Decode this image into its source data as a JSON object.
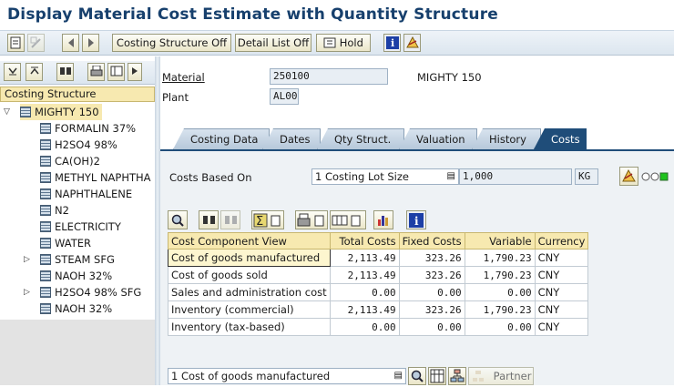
{
  "title": "Display Material Cost Estimate with Quantity Structure",
  "toolbar": {
    "costing_structure_off": "Costing Structure Off",
    "detail_list_off": "Detail List Off",
    "hold": "Hold"
  },
  "left_panel": {
    "header": "Costing Structure",
    "root": "MIGHTY 150",
    "items": [
      {
        "label": "FORMALIN 37%"
      },
      {
        "label": "H2SO4 98%"
      },
      {
        "label": "CA(OH)2"
      },
      {
        "label": "METHYL NAPHTHA"
      },
      {
        "label": "NAPHTHALENE"
      },
      {
        "label": "N2"
      },
      {
        "label": "ELECTRICITY"
      },
      {
        "label": "WATER"
      },
      {
        "label": "STEAM SFG"
      },
      {
        "label": "NAOH 32%"
      },
      {
        "label": "H2SO4 98% SFG"
      },
      {
        "label": "NAOH 32%"
      }
    ]
  },
  "header_fields": {
    "material_label": "Material",
    "material_value": "250100",
    "material_desc": "MIGHTY 150",
    "plant_label": "Plant",
    "plant_value": "AL00"
  },
  "tabs": [
    "Costing Data",
    "Dates",
    "Qty Struct.",
    "Valuation",
    "History",
    "Costs"
  ],
  "active_tab": "Costs",
  "costs_based_on": {
    "label": "Costs Based On",
    "value": "1 Costing Lot Size",
    "quantity": "1,000",
    "unit": "KG"
  },
  "table": {
    "headers": [
      "Cost Component View",
      "Total Costs",
      "Fixed Costs",
      "Variable",
      "Currency"
    ],
    "rows": [
      [
        "Cost of goods manufactured",
        "2,113.49",
        "323.26",
        "1,790.23",
        "CNY"
      ],
      [
        "Cost of goods sold",
        "2,113.49",
        "323.26",
        "1,790.23",
        "CNY"
      ],
      [
        "Sales and administration cost",
        "0.00",
        "0.00",
        "0.00",
        "CNY"
      ],
      [
        "Inventory (commercial)",
        "2,113.49",
        "323.26",
        "1,790.23",
        "CNY"
      ],
      [
        "Inventory (tax-based)",
        "0.00",
        "0.00",
        "0.00",
        "CNY"
      ]
    ]
  },
  "bottom": {
    "view_select": "1 Cost of goods manufactured",
    "partner_label": "Partner"
  },
  "colors": {
    "title": "#17406d",
    "active_tab": "#1f4d79",
    "header_yellow": "#f7e9b0"
  }
}
